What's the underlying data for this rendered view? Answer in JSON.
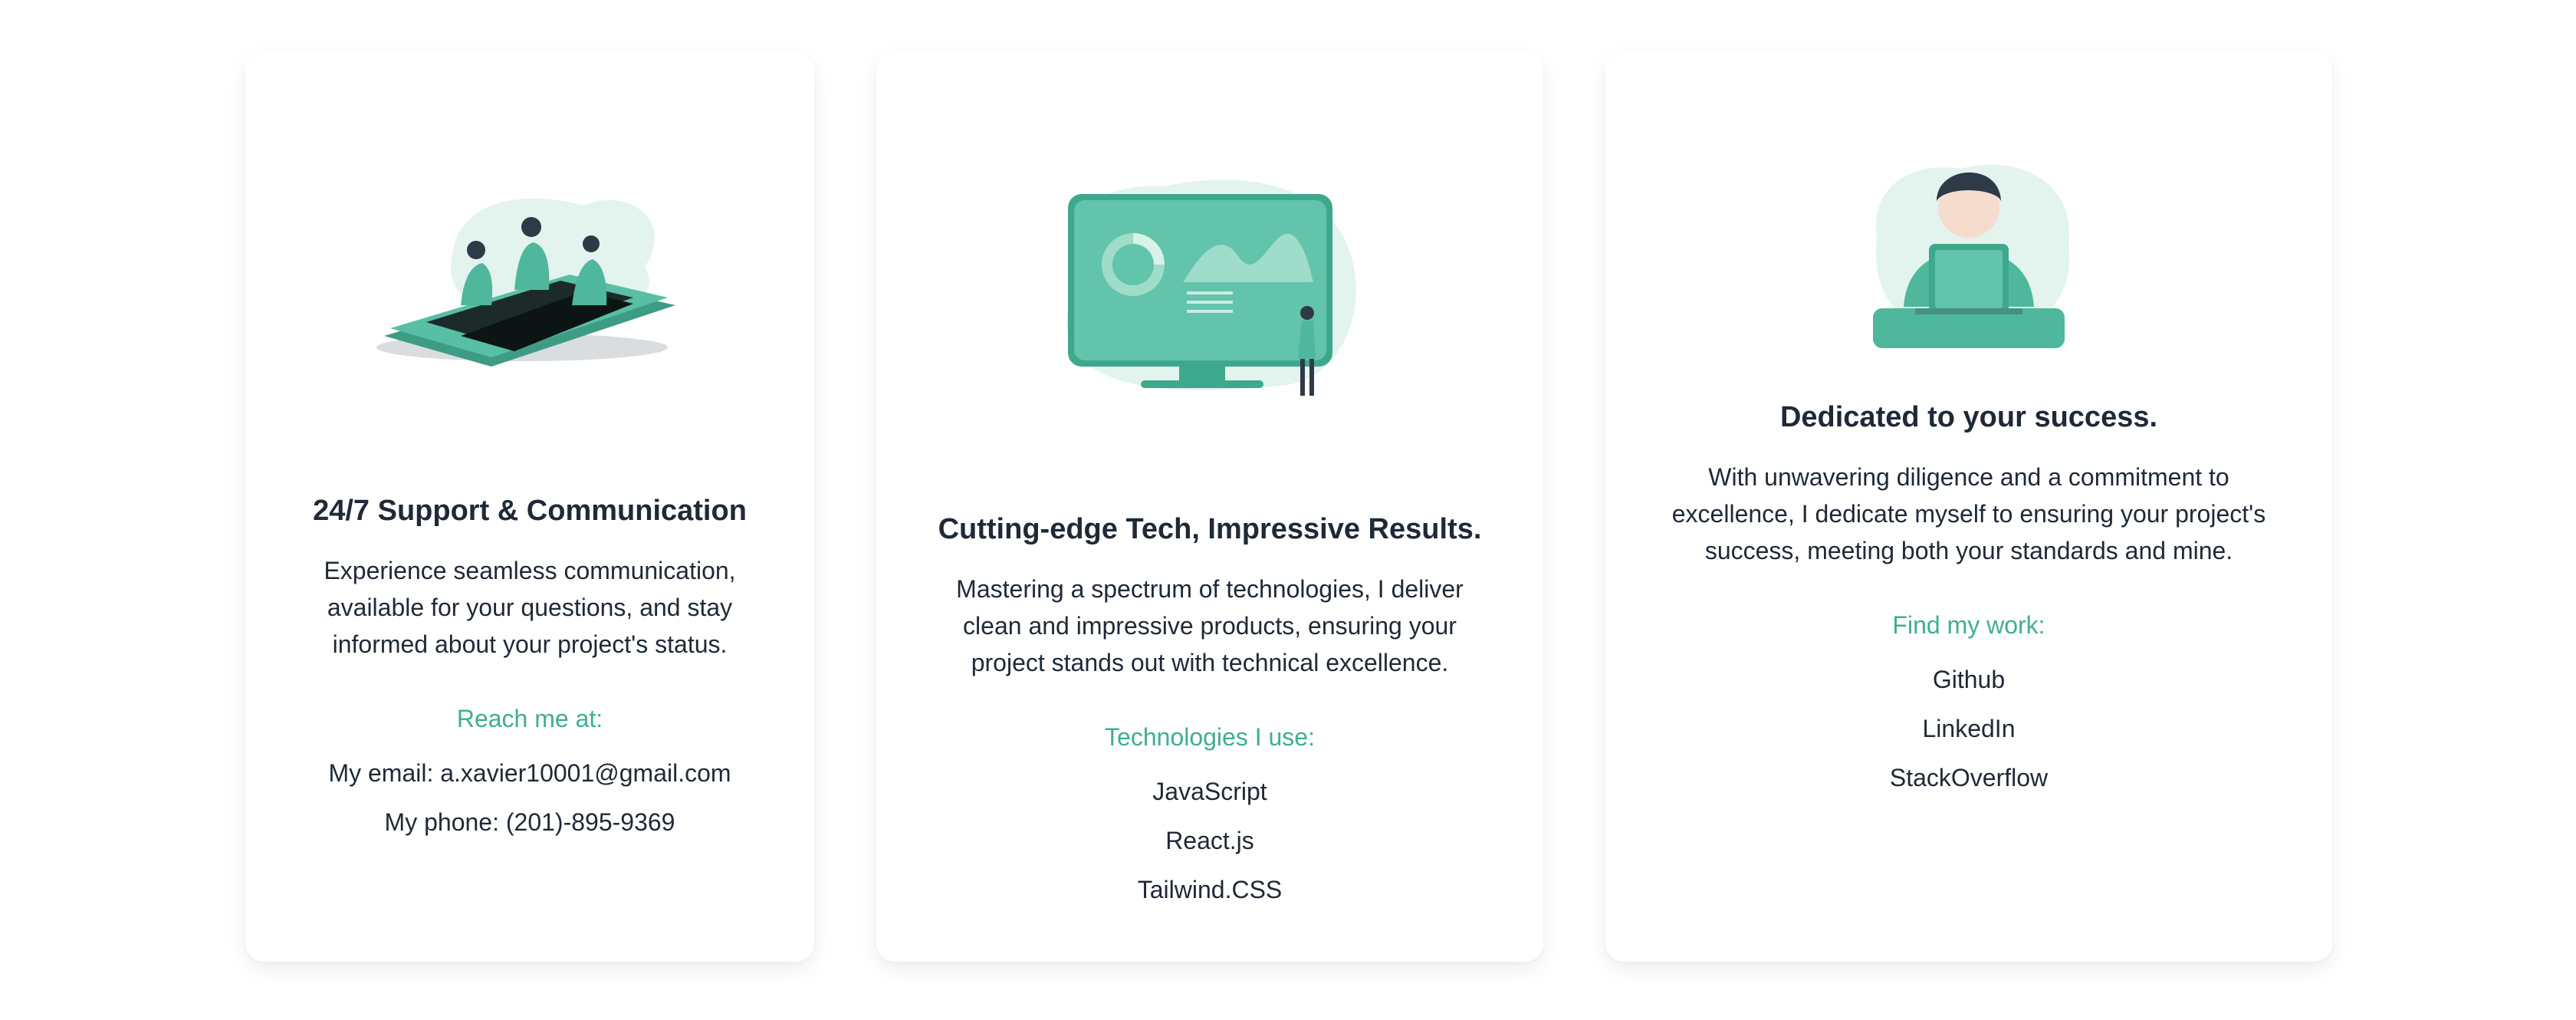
{
  "cards": [
    {
      "illustration": "team-on-phone-illustration",
      "title": "24/7 Support & Communication",
      "description": "Experience seamless communication, available for your questions, and stay informed about your project's status.",
      "subheading": "Reach me at:",
      "items": [
        "My email: a.xavier10001@gmail.com",
        "My phone: (201)-895-9369"
      ]
    },
    {
      "illustration": "monitor-dashboard-illustration",
      "title": "Cutting-edge Tech, Impressive Results.",
      "description": "Mastering a spectrum of technologies, I deliver clean and impressive products, ensuring your project stands out with technical excellence.",
      "subheading": "Technologies I use:",
      "items": [
        "JavaScript",
        "React.js",
        "Tailwind.CSS"
      ]
    },
    {
      "illustration": "person-with-laptop-illustration",
      "title": "Dedicated to your success.",
      "description": "With unwavering diligence and a commitment to excellence, I dedicate myself to ensuring your project's success, meeting both your standards and mine.",
      "subheading": "Find my work:",
      "items": [
        "Github",
        "LinkedIn",
        "StackOverflow"
      ]
    }
  ],
  "colors": {
    "accent": "#3fae93",
    "text": "#1f2937",
    "illustration": "#4fb79c",
    "blob": "#e3f3ee"
  }
}
